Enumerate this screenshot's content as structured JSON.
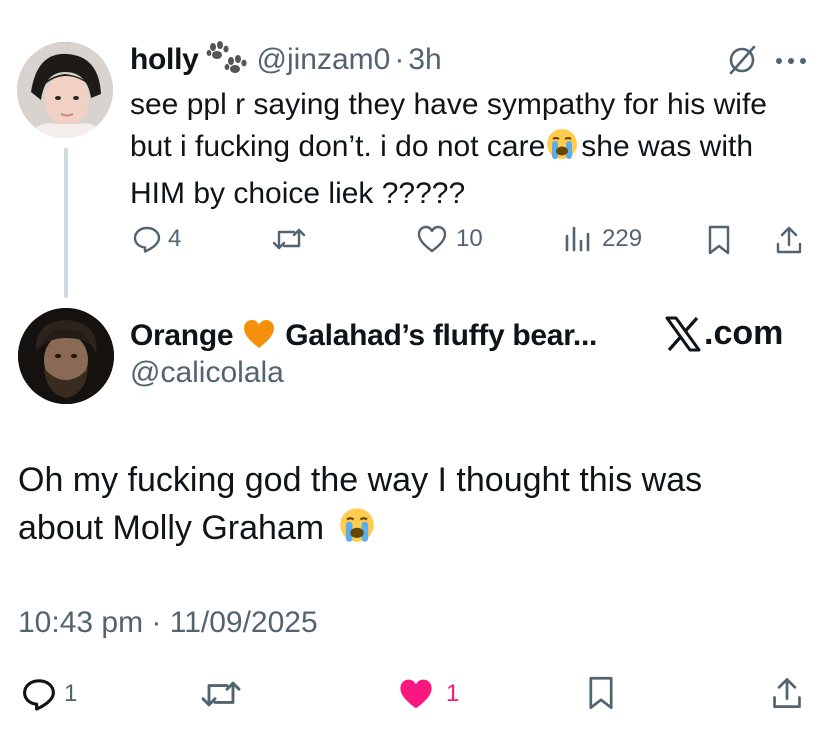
{
  "quoted": {
    "name": "holly",
    "name_emoji": "paw-prints-icon",
    "handle": "@jinzam0",
    "sep": "·",
    "time": "3h",
    "text_line1": "see ppl r saying they have sympathy for his wife",
    "text_line2a": "but i fucking don’t. i do not care",
    "text_line2b": "she was with",
    "text_line3": "HIM by choice liek ?????",
    "stats": {
      "replies": "4",
      "reposts": "",
      "likes": "10",
      "views": "229"
    }
  },
  "reply": {
    "name_a": "Orange",
    "name_b": "Galahad’s fluffy bear...",
    "name_emoji": "orange-heart-icon",
    "handle": "@calicolala",
    "watermark": "X.com",
    "text_line1": "Oh my fucking god the way I thought this was",
    "text_line2": "about Molly Graham",
    "timestamp": "10:43 pm · 11/09/2025",
    "stats": {
      "replies": "1",
      "reposts": "",
      "likes": "1"
    }
  },
  "colors": {
    "text": "#0f1419",
    "muted": "#536471",
    "like_active": "#f91880",
    "heart_emoji": "#f4900c",
    "thread_line": "#cfd9de"
  }
}
